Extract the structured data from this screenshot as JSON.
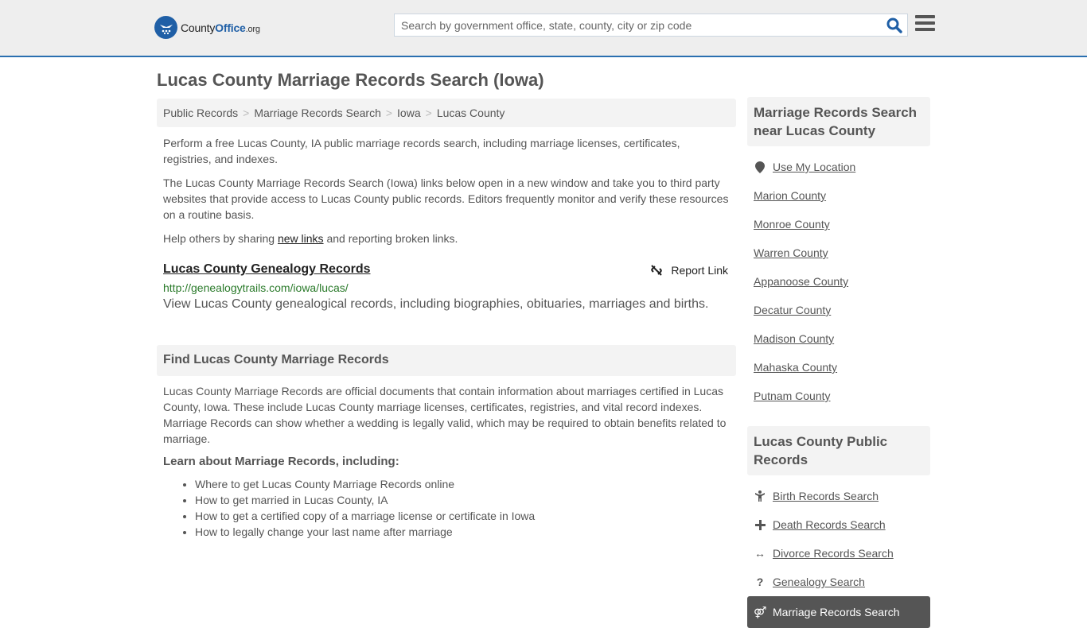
{
  "header": {
    "logo": {
      "county": "County",
      "office": "Office",
      "org": ".org"
    },
    "search_placeholder": "Search by government office, state, county, city or zip code",
    "search_icon": "search-icon",
    "menu_icon": "hamburger-menu-icon"
  },
  "page": {
    "title": "Lucas County Marriage Records Search (Iowa)",
    "breadcrumb": [
      "Public Records",
      "Marriage Records Search",
      "Iowa",
      "Lucas County"
    ],
    "breadcrumb_separator": ">"
  },
  "intro": {
    "p1": "Perform a free Lucas County, IA public marriage records search, including marriage licenses, certificates, registries, and indexes.",
    "p2": "The Lucas County Marriage Records Search (Iowa) links below open in a new window and take you to third party websites that provide access to Lucas County public records. Editors frequently monitor and verify these resources on a routine basis.",
    "p3_before": "Help others by sharing ",
    "p3_link": "new links",
    "p3_after": " and reporting broken links."
  },
  "result": {
    "title": "Lucas County Genealogy Records",
    "report_label": "Report Link",
    "url": "http://genealogytrails.com/iowa/lucas/",
    "description": "View Lucas County genealogical records, including biographies, obituaries, marriages and births."
  },
  "find_section": {
    "heading": "Find Lucas County Marriage Records",
    "body": "Lucas County Marriage Records are official documents that contain information about marriages certified in Lucas County, Iowa. These include Lucas County marriage licenses, certificates, registries, and vital record indexes. Marriage Records can show whether a wedding is legally valid, which may be required to obtain benefits related to marriage.",
    "learn_heading": "Learn about Marriage Records, including:",
    "learn_items": [
      "Where to get Lucas County Marriage Records online",
      "How to get married in Lucas County, IA",
      "How to get a certified copy of a marriage license or certificate in Iowa",
      "How to legally change your last name after marriage"
    ]
  },
  "sidebar": {
    "nearby_heading": "Marriage Records Search near Lucas County",
    "use_location": "Use My Location",
    "nearby": [
      "Marion County",
      "Monroe County",
      "Warren County",
      "Appanoose County",
      "Decatur County",
      "Madison County",
      "Mahaska County",
      "Putnam County"
    ],
    "public_heading": "Lucas County Public Records",
    "public_links": [
      {
        "label": "Birth Records Search",
        "icon": "child-icon"
      },
      {
        "label": "Death Records Search",
        "icon": "cross-icon"
      },
      {
        "label": "Divorce Records Search",
        "icon": "double-arrow-icon"
      },
      {
        "label": "Genealogy Search",
        "icon": "question-icon"
      }
    ],
    "active_link": {
      "label": "Marriage Records Search",
      "icon": "marriage-icon"
    }
  },
  "colors": {
    "brand_blue": "#1f5fa6",
    "url_green": "#2a7a2a",
    "text": "#555555"
  }
}
